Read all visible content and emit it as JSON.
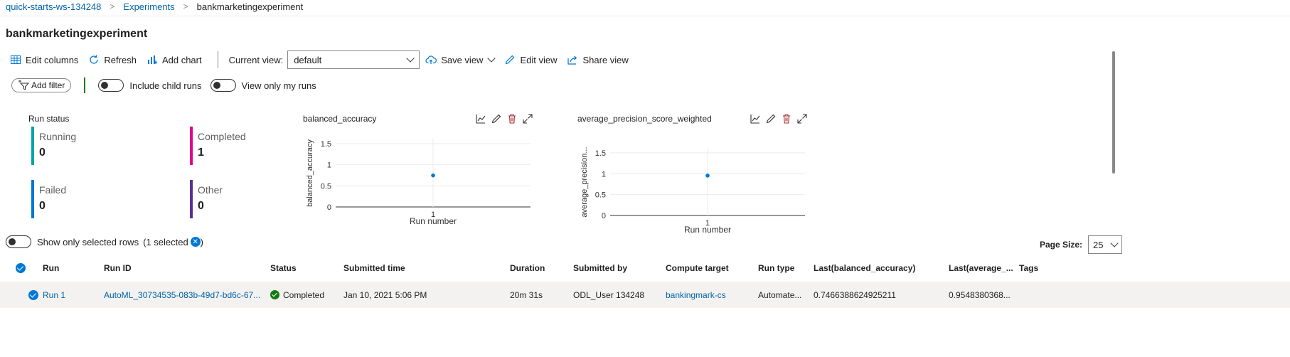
{
  "breadcrumb": {
    "workspace": "quick-starts-ws-134248",
    "experiments": "Experiments",
    "current": "bankmarketingexperiment"
  },
  "page_title": "bankmarketingexperiment",
  "toolbar": {
    "edit_columns": "Edit columns",
    "refresh": "Refresh",
    "add_chart": "Add chart",
    "current_view_label": "Current view:",
    "current_view_value": "default",
    "save_view": "Save view",
    "edit_view": "Edit view",
    "share_view": "Share view"
  },
  "filters": {
    "add_filter": "Add filter",
    "include_child_runs": "Include child runs",
    "view_only_my_runs": "View only my runs"
  },
  "run_status": {
    "title": "Run status",
    "cards": [
      {
        "label": "Running",
        "value": "0",
        "color": "#00a5a5"
      },
      {
        "label": "Completed",
        "value": "1",
        "color": "#e3008c"
      },
      {
        "label": "Failed",
        "value": "0",
        "color": "#0078d4"
      },
      {
        "label": "Other",
        "value": "0",
        "color": "#5c2d91"
      }
    ]
  },
  "chart_data": [
    {
      "type": "scatter",
      "title": "balanced_accuracy",
      "xlabel": "Run number",
      "ylabel": "balanced_accuracy",
      "x_ticks": [
        "1"
      ],
      "y_ticks": [
        "0",
        "0.5",
        "1",
        "1.5"
      ],
      "ylim": [
        0,
        1.6
      ],
      "points": [
        {
          "x": 1,
          "y": 0.7466
        }
      ],
      "color": "#0078d4"
    },
    {
      "type": "scatter",
      "title": "average_precision_score_weighted",
      "xlabel": "Run number",
      "ylabel": "average_precision...",
      "x_ticks": [
        "1"
      ],
      "y_ticks": [
        "0",
        "0.5",
        "1",
        "1.5"
      ],
      "ylim": [
        0,
        1.6
      ],
      "points": [
        {
          "x": 1,
          "y": 0.9548
        }
      ],
      "color": "#0078d4"
    }
  ],
  "selection": {
    "show_only_selected": "Show only selected rows",
    "selected_count": "(1 selected",
    "selected_close": ")"
  },
  "page_size": {
    "label": "Page Size:",
    "value": "25"
  },
  "table": {
    "headers": [
      "Run",
      "Run ID",
      "Status",
      "Submitted time",
      "Duration",
      "Submitted by",
      "Compute target",
      "Run type",
      "Last(balanced_accuracy)",
      "Last(average_...",
      "Tags"
    ],
    "rows": [
      {
        "run": "Run 1",
        "run_id": "AutoML_30734535-083b-49d7-bd6c-67...",
        "status": "Completed",
        "submitted_time": "Jan 10, 2021 5:06 PM",
        "duration": "20m 31s",
        "submitted_by": "ODL_User 134248",
        "compute_target": "bankingmark-cs",
        "run_type": "Automate...",
        "last_balanced_accuracy": "0.7466388624925211",
        "last_average": "0.9548380368...",
        "tags": ""
      }
    ]
  }
}
